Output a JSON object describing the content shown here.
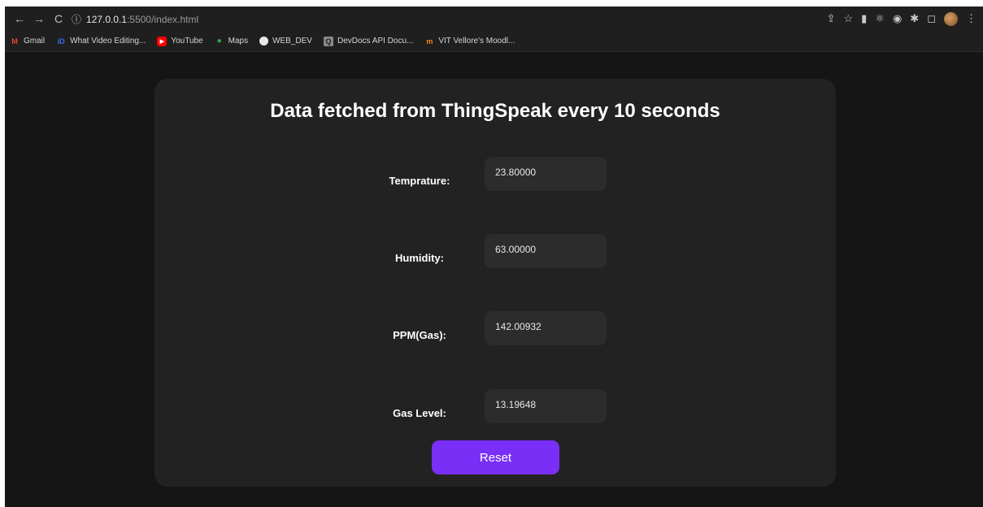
{
  "browser": {
    "url_host": "127.0.0.1",
    "url_path": ":5500/index.html",
    "bookmarks": [
      {
        "label": "Gmail",
        "icon": "gmail-icon",
        "color": "#ea4335",
        "glyph": "M"
      },
      {
        "label": "What Video Editing...",
        "icon": "video-editing-icon",
        "color": "#3b6df0",
        "glyph": "iD"
      },
      {
        "label": "YouTube",
        "icon": "youtube-icon",
        "color": "#ff0000",
        "glyph": "▶"
      },
      {
        "label": "Maps",
        "icon": "maps-icon",
        "color": "#34a853",
        "glyph": "⬤"
      },
      {
        "label": "WEB_DEV",
        "icon": "folder-icon",
        "color": "#e8e8e8",
        "glyph": "●"
      },
      {
        "label": "DevDocs API Docu...",
        "icon": "devdocs-icon",
        "color": "#8a8a8a",
        "glyph": "Q"
      },
      {
        "label": "VIT Vellore's Moodl...",
        "icon": "moodle-icon",
        "color": "#f98012",
        "glyph": "m"
      }
    ]
  },
  "page": {
    "title": "Data fetched from ThingSpeak every 10 seconds",
    "fields": [
      {
        "label": "Temprature:",
        "value": "23.80000"
      },
      {
        "label": "Humidity:",
        "value": "63.00000"
      },
      {
        "label": "PPM(Gas):",
        "value": "142.00932"
      },
      {
        "label": "Gas Level:",
        "value": "13.19648"
      }
    ],
    "reset_label": "Reset"
  },
  "colors": {
    "accent": "#7a2ff6",
    "card_bg": "#222222",
    "page_bg": "#151515"
  }
}
